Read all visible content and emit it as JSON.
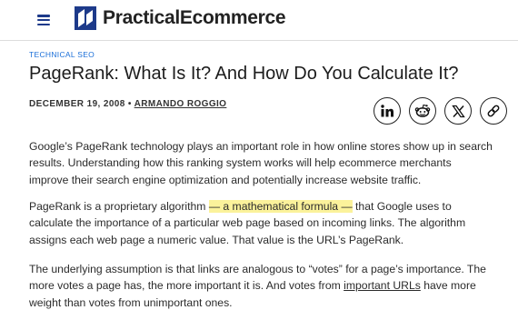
{
  "header": {
    "menu_icon": "hamburger-menu-icon",
    "brand_name": "PracticalEcommerce",
    "brand_color": "#1d3a8a"
  },
  "article": {
    "category": "TECHNICAL SEO",
    "title": "PageRank: What Is It? And How Do You Calculate It?",
    "date": "DECEMBER 19, 2008",
    "separator": "•",
    "author": "ARMANDO ROGGIO",
    "share_icons": [
      "linkedin-icon",
      "reddit-icon",
      "x-icon",
      "link-icon"
    ],
    "paragraphs": [
      {
        "text": "Google’s PageRank technology plays an important role in how online stores show up in search results. Understanding how this ranking system works will help ecommerce merchants improve their search engine optimization and potentially increase website traffic."
      },
      {
        "before": "PageRank is a proprietary algorithm ",
        "highlight": "— a mathematical formula —",
        "after": " that Google uses to calculate the importance of a particular web page based on incoming links. The algorithm assigns each web page a numeric value. That value is the URL’s PageRank."
      },
      {
        "before": "The underlying assumption is that links are analogous to “votes” for a page’s importance. The more votes a page has, the more important it is. And votes from ",
        "link": "important URLs",
        "after": " have more weight than votes from unimportant ones."
      }
    ],
    "highlight_color": "#fbf29b",
    "link_color": "#1b6fd8"
  }
}
